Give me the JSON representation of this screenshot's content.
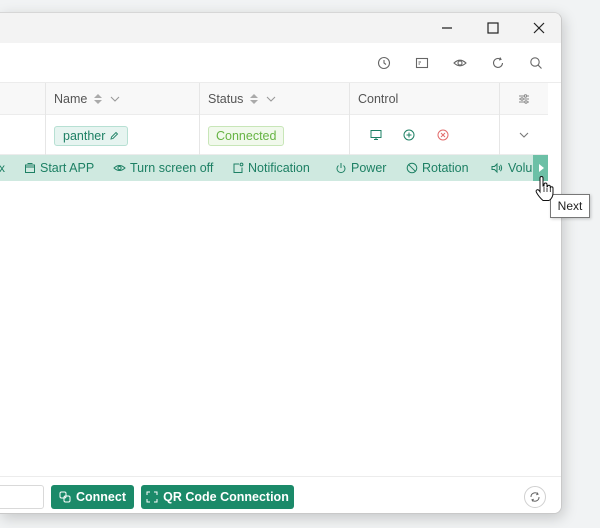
{
  "table": {
    "columns": [
      {
        "label": "Name"
      },
      {
        "label": "Status"
      },
      {
        "label": "Control"
      }
    ],
    "row": {
      "name": "panther",
      "status": "Connected"
    }
  },
  "actions": [
    {
      "label": "Start APP",
      "icon": "app-icon"
    },
    {
      "label": "Turn screen off",
      "icon": "eye-icon"
    },
    {
      "label": "Notification",
      "icon": "notification-icon"
    },
    {
      "label": "Power",
      "icon": "power-icon"
    },
    {
      "label": "Rotation",
      "icon": "rotation-icon"
    },
    {
      "label": "Volu",
      "icon": "volume-icon"
    }
  ],
  "tooltip": {
    "text": "Next"
  },
  "footer": {
    "connect_label": "Connect",
    "qr_label": "QR Code Connection"
  },
  "colors": {
    "accent": "#1b8a69",
    "action_bar_bg": "#cfe9e0",
    "status_green": "#67b444"
  }
}
